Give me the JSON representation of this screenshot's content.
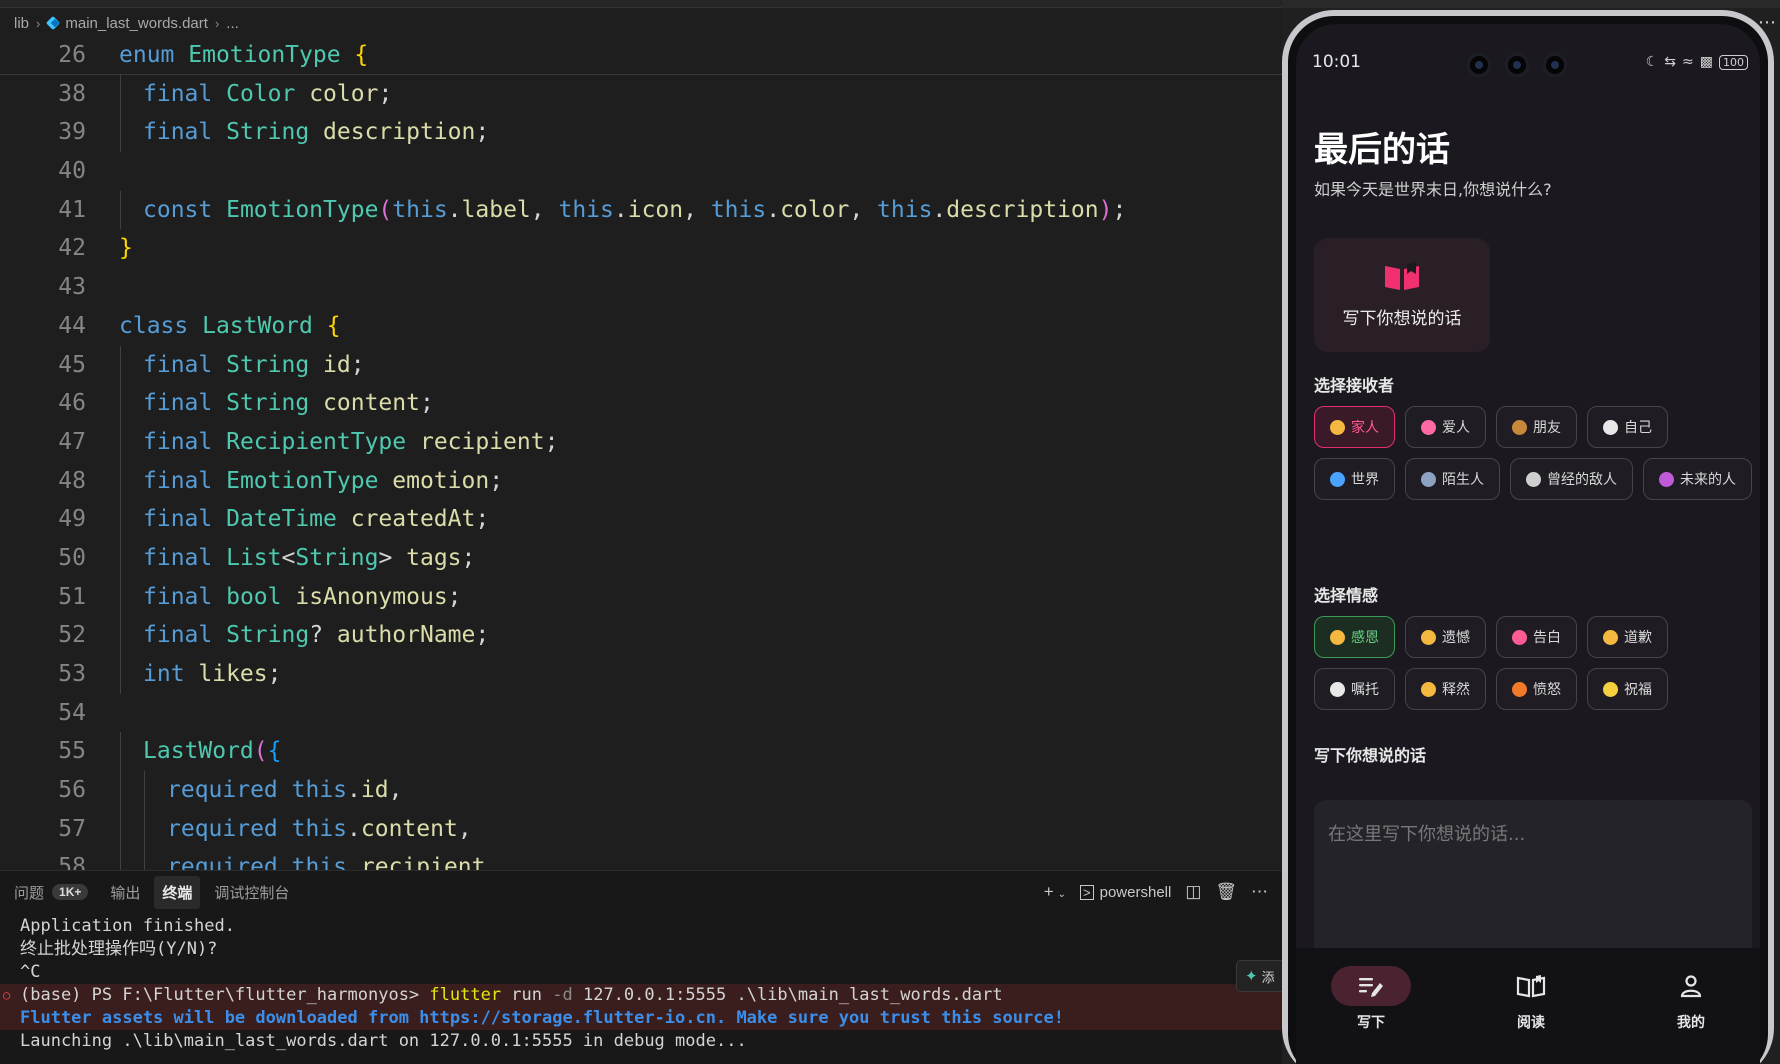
{
  "editor": {
    "breadcrumb": [
      "lib",
      "main_last_words.dart",
      "..."
    ],
    "lines": [
      {
        "n": "26",
        "indent": 0,
        "parts": [
          [
            "kw",
            "enum "
          ],
          [
            "ty",
            "EmotionType "
          ],
          [
            "br1",
            "{"
          ]
        ]
      },
      {
        "n": "38",
        "indent": 1,
        "parts": [
          [
            "kw",
            "final "
          ],
          [
            "ty",
            "Color "
          ],
          [
            "fd",
            "color"
          ],
          [
            "pt",
            ";"
          ]
        ]
      },
      {
        "n": "39",
        "indent": 1,
        "parts": [
          [
            "kw",
            "final "
          ],
          [
            "ty",
            "String "
          ],
          [
            "fd",
            "description"
          ],
          [
            "pt",
            ";"
          ]
        ]
      },
      {
        "n": "40",
        "indent": 0,
        "parts": []
      },
      {
        "n": "41",
        "indent": 1,
        "parts": [
          [
            "kw",
            "const "
          ],
          [
            "ty",
            "EmotionType"
          ],
          [
            "br2",
            "("
          ],
          [
            "tv",
            "this"
          ],
          [
            "pt",
            "."
          ],
          [
            "fd",
            "label"
          ],
          [
            "pt",
            ", "
          ],
          [
            "tv",
            "this"
          ],
          [
            "pt",
            "."
          ],
          [
            "fd",
            "icon"
          ],
          [
            "pt",
            ", "
          ],
          [
            "tv",
            "this"
          ],
          [
            "pt",
            "."
          ],
          [
            "fd",
            "color"
          ],
          [
            "pt",
            ", "
          ],
          [
            "tv",
            "this"
          ],
          [
            "pt",
            "."
          ],
          [
            "fd",
            "description"
          ],
          [
            "br2",
            ")"
          ],
          [
            "pt",
            ";"
          ]
        ]
      },
      {
        "n": "42",
        "indent": 0,
        "parts": [
          [
            "br1",
            "}"
          ]
        ]
      },
      {
        "n": "43",
        "indent": 0,
        "parts": []
      },
      {
        "n": "44",
        "indent": 0,
        "parts": [
          [
            "kw",
            "class "
          ],
          [
            "ty",
            "LastWord "
          ],
          [
            "br1",
            "{"
          ]
        ]
      },
      {
        "n": "45",
        "indent": 1,
        "parts": [
          [
            "kw",
            "final "
          ],
          [
            "ty",
            "String "
          ],
          [
            "fd",
            "id"
          ],
          [
            "pt",
            ";"
          ]
        ]
      },
      {
        "n": "46",
        "indent": 1,
        "parts": [
          [
            "kw",
            "final "
          ],
          [
            "ty",
            "String "
          ],
          [
            "fd",
            "content"
          ],
          [
            "pt",
            ";"
          ]
        ]
      },
      {
        "n": "47",
        "indent": 1,
        "parts": [
          [
            "kw",
            "final "
          ],
          [
            "ty",
            "RecipientType "
          ],
          [
            "fd",
            "recipient"
          ],
          [
            "pt",
            ";"
          ]
        ]
      },
      {
        "n": "48",
        "indent": 1,
        "parts": [
          [
            "kw",
            "final "
          ],
          [
            "ty",
            "EmotionType "
          ],
          [
            "fd",
            "emotion"
          ],
          [
            "pt",
            ";"
          ]
        ]
      },
      {
        "n": "49",
        "indent": 1,
        "parts": [
          [
            "kw",
            "final "
          ],
          [
            "ty",
            "DateTime "
          ],
          [
            "fd",
            "createdAt"
          ],
          [
            "pt",
            ";"
          ]
        ]
      },
      {
        "n": "50",
        "indent": 1,
        "parts": [
          [
            "kw",
            "final "
          ],
          [
            "ty",
            "List"
          ],
          [
            "pt",
            "<"
          ],
          [
            "ty",
            "String"
          ],
          [
            "pt",
            "> "
          ],
          [
            "fd",
            "tags"
          ],
          [
            "pt",
            ";"
          ]
        ]
      },
      {
        "n": "51",
        "indent": 1,
        "parts": [
          [
            "kw",
            "final "
          ],
          [
            "ty",
            "bool "
          ],
          [
            "fd",
            "isAnonymous"
          ],
          [
            "pt",
            ";"
          ]
        ]
      },
      {
        "n": "52",
        "indent": 1,
        "parts": [
          [
            "kw",
            "final "
          ],
          [
            "ty",
            "String"
          ],
          [
            "pt",
            "? "
          ],
          [
            "fd",
            "authorName"
          ],
          [
            "pt",
            ";"
          ]
        ]
      },
      {
        "n": "53",
        "indent": 1,
        "parts": [
          [
            "kw",
            "int "
          ],
          [
            "fd",
            "likes"
          ],
          [
            "pt",
            ";"
          ]
        ]
      },
      {
        "n": "54",
        "indent": 0,
        "parts": []
      },
      {
        "n": "55",
        "indent": 1,
        "parts": [
          [
            "ty",
            "LastWord"
          ],
          [
            "br2",
            "("
          ],
          [
            "br3",
            "{"
          ]
        ]
      },
      {
        "n": "56",
        "indent": 2,
        "parts": [
          [
            "kw",
            "required "
          ],
          [
            "tv",
            "this"
          ],
          [
            "pt",
            "."
          ],
          [
            "fd",
            "id"
          ],
          [
            "pt",
            ","
          ]
        ]
      },
      {
        "n": "57",
        "indent": 2,
        "parts": [
          [
            "kw",
            "required "
          ],
          [
            "tv",
            "this"
          ],
          [
            "pt",
            "."
          ],
          [
            "fd",
            "content"
          ],
          [
            "pt",
            ","
          ]
        ]
      },
      {
        "n": "58",
        "indent": 2,
        "parts": [
          [
            "kw",
            "required "
          ],
          [
            "tv",
            "this"
          ],
          [
            "pt",
            "."
          ],
          [
            "fd",
            "recipient"
          ],
          [
            "pt",
            ","
          ]
        ]
      }
    ]
  },
  "panel": {
    "tabs": [
      {
        "label": "问题",
        "badge": "1K+"
      },
      {
        "label": "输出"
      },
      {
        "label": "终端",
        "active": true
      },
      {
        "label": "调试控制台"
      }
    ],
    "shell_label": "powershell",
    "add_chip_label": "添",
    "terminal": {
      "line1": "Application finished.",
      "line2": "终止批处理操作吗(Y/N)?",
      "line3": "^C",
      "prompt": "(base) PS F:\\Flutter\\flutter_harmonyos> ",
      "cmd": "flutter",
      "cmd_rest_1": " run ",
      "flag": "-d",
      "cmd_rest_2": " 127.0.0.1:5555 .\\lib\\main_last_words.dart",
      "info": "Flutter assets will be downloaded from https://storage.flutter-io.cn. Make sure you trust this source!",
      "launching": "Launching .\\lib\\main_last_words.dart on 127.0.0.1:5555 in debug mode..."
    }
  },
  "phone": {
    "status_time": "10:01",
    "battery": "100",
    "title": "最后的话",
    "subtitle": "如果今天是世界末日,你想说什么?",
    "write_card_label": "写下你想说的话",
    "recipient_label": "选择接收者",
    "recipients": [
      {
        "label": "家人",
        "emoji_color": "#f4b740",
        "selected": true
      },
      {
        "label": "爱人",
        "emoji_color": "#ff6aa6"
      },
      {
        "label": "朋友",
        "emoji_color": "#c9873a"
      },
      {
        "label": "自己",
        "emoji_color": "#e8e8e8"
      },
      {
        "label": "世界",
        "emoji_color": "#4aa3ff"
      },
      {
        "label": "陌生人",
        "emoji_color": "#8da2c0"
      },
      {
        "label": "曾经的敌人",
        "emoji_color": "#cfcfcf"
      },
      {
        "label": "未来的人",
        "emoji_color": "#c05ad8"
      }
    ],
    "emotion_label": "选择情感",
    "emotions": [
      {
        "label": "感恩",
        "emoji_color": "#f4b740",
        "selected": true
      },
      {
        "label": "遗憾",
        "emoji_color": "#f4b740"
      },
      {
        "label": "告白",
        "emoji_color": "#ff5b93"
      },
      {
        "label": "道歉",
        "emoji_color": "#f4b740"
      },
      {
        "label": "嘱托",
        "emoji_color": "#e8e8e8"
      },
      {
        "label": "释然",
        "emoji_color": "#f4b740"
      },
      {
        "label": "愤怒",
        "emoji_color": "#f07a2a"
      },
      {
        "label": "祝福",
        "emoji_color": "#f4d03f"
      }
    ],
    "write_label": "写下你想说的话",
    "textarea_placeholder": "在这里写下你想说的话...",
    "nav": [
      {
        "label": "写下",
        "active": true
      },
      {
        "label": "阅读"
      },
      {
        "label": "我的"
      }
    ]
  },
  "colors": {
    "accent_pink": "#e0306f",
    "accent_green": "#3a9a56"
  }
}
